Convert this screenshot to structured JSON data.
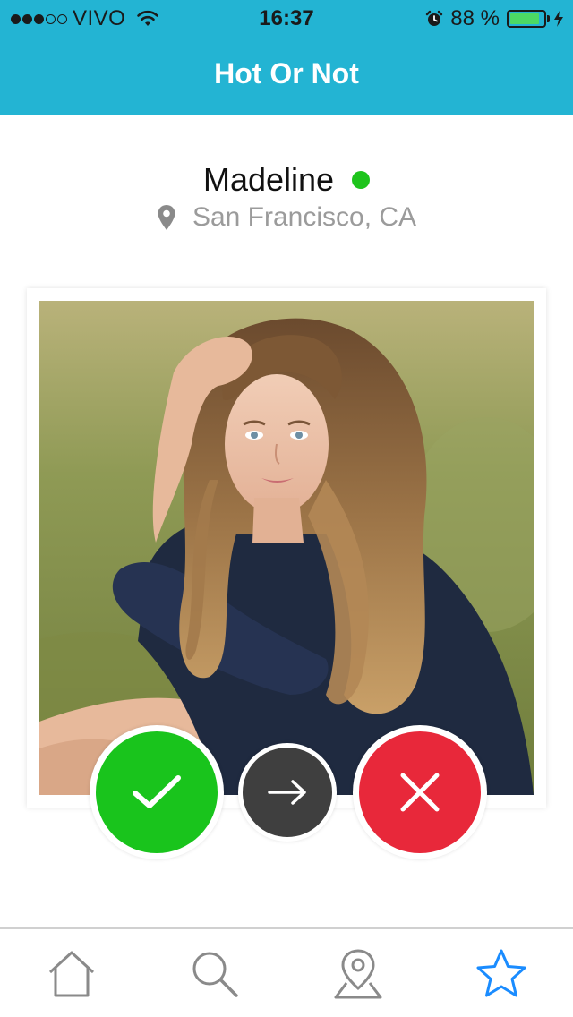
{
  "status_bar": {
    "carrier": "VIVO",
    "time": "16:37",
    "battery": "88 %",
    "battery_level": 0.88
  },
  "header": {
    "title": "Hot Or Not"
  },
  "profile": {
    "name": "Madeline",
    "online": true,
    "location": "San Francisco, CA"
  },
  "actions": {
    "like_icon": "checkmark-icon",
    "skip_icon": "arrow-right-icon",
    "nope_icon": "close-icon"
  },
  "tabs": [
    {
      "icon": "home-icon",
      "active": false
    },
    {
      "icon": "search-icon",
      "active": false
    },
    {
      "icon": "map-pin-icon",
      "active": false
    },
    {
      "icon": "star-icon",
      "active": true
    }
  ],
  "colors": {
    "header": "#23b4d3",
    "like": "#19c41c",
    "skip": "#3f3f3f",
    "nope": "#e8283a",
    "online": "#1ec41c",
    "tab_active": "#1a8cff",
    "tab_inactive": "#8a8a8a"
  }
}
